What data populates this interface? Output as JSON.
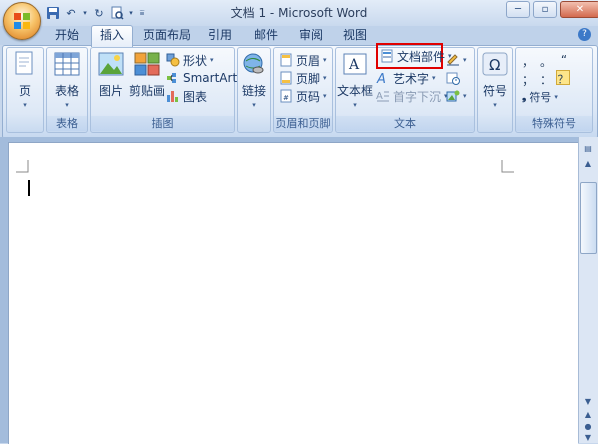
{
  "window": {
    "title": "文档 1 - Microsoft Word",
    "minimize": "─",
    "restore": "▫",
    "close": "✕"
  },
  "qat": {
    "save": "💾",
    "undo": "↶",
    "redo": "↻",
    "preview": "🔍",
    "customize": "▾"
  },
  "tabs": [
    "开始",
    "插入",
    "页面布局",
    "引用",
    "邮件",
    "审阅",
    "视图"
  ],
  "active_tab": "插入",
  "help": "?",
  "ribbon": {
    "pages": {
      "button": "页",
      "group": ""
    },
    "tables": {
      "button": "表格",
      "group": "表格"
    },
    "illustrations": {
      "group": "插图",
      "picture": "图片",
      "clipart": "剪贴画",
      "shapes": "形状",
      "smartart": "SmartArt",
      "chart": "图表"
    },
    "links": {
      "button": "链接",
      "group": ""
    },
    "header_footer": {
      "group": "页眉和页脚",
      "header": "页眉",
      "footer": "页脚",
      "page_number": "页码"
    },
    "text": {
      "group": "文本",
      "textbox": "文本框",
      "quick_parts": "文档部件",
      "wordart": "艺术字",
      "dropcap": "首字下沉"
    },
    "symbols": {
      "button": "符号",
      "group": ""
    },
    "special_symbols": {
      "group": "特殊符号",
      "comma": "，",
      "period": "。",
      "left_quote": "“",
      "semicolon": "；",
      "colon": "：",
      "question": "？",
      "symbol_menu": "符号"
    }
  },
  "colors": {
    "highlight": "#e00000",
    "ribbon_text": "#1d3a66"
  }
}
